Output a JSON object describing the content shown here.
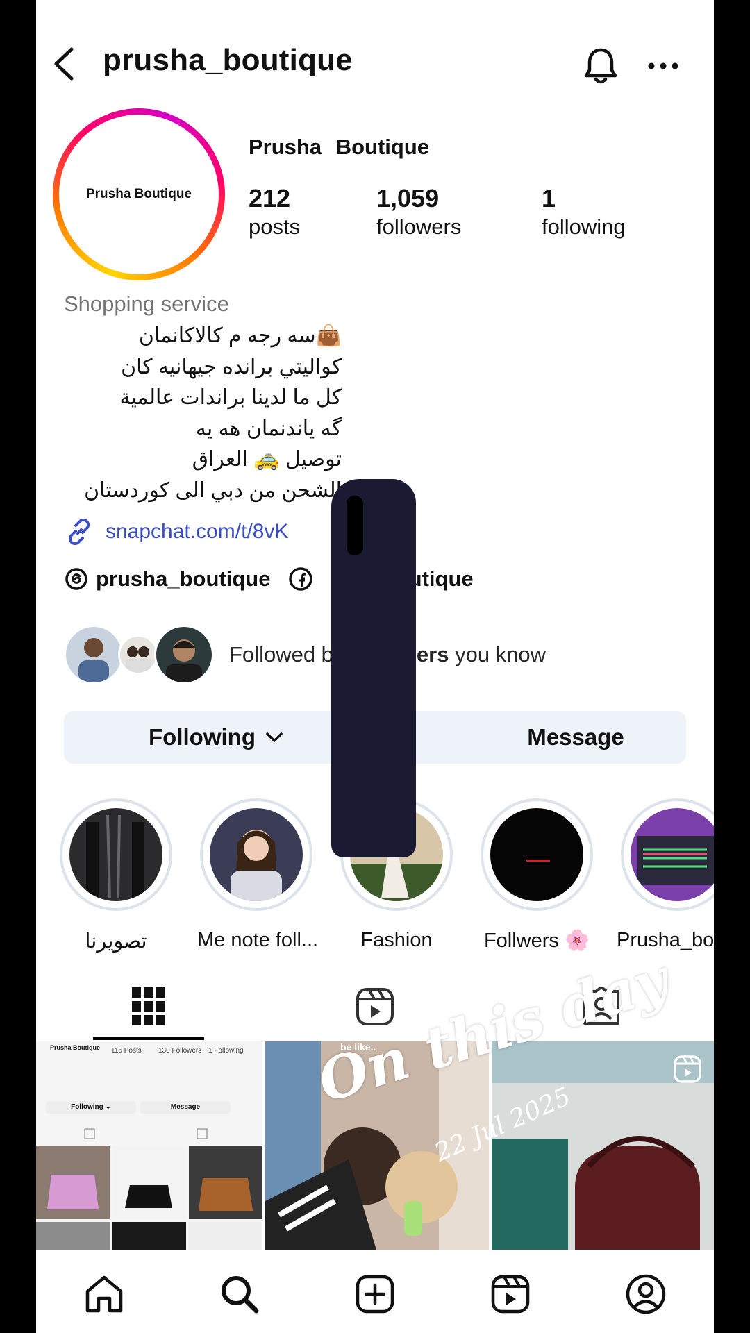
{
  "header": {
    "username": "prusha_boutique"
  },
  "profile": {
    "avatar_text": "Prusha Boutique",
    "display_name": "Prusha Boutique",
    "stats": [
      {
        "value": "212",
        "label": "posts"
      },
      {
        "value": "1,059",
        "label": "followers"
      },
      {
        "value": "1",
        "label": "following"
      }
    ]
  },
  "bio": {
    "category": "Shopping service",
    "lines": [
      "👜سه رجه م كالاكانمان",
      "كواليتي برانده جيهانيه كان",
      "كل ما لدينا براندات عالمية",
      "گه یاندنمان هه یه",
      "توصيل 🚕 العراق",
      "الشحن من دبي الى كوردستان"
    ],
    "link": "snapchat.com/t/8vK"
  },
  "social": {
    "threads": "prusha_boutique",
    "facebook": "a Boutique"
  },
  "followed_by": {
    "text_start": "Followed b",
    "text_bold": "ers",
    "text_end": " you know"
  },
  "actions": {
    "following_label": "Following",
    "message_label": "Message"
  },
  "highlights": [
    {
      "label": "تصويرنا"
    },
    {
      "label": "Me note foll..."
    },
    {
      "label": "Fashion"
    },
    {
      "label": "Follwers 🌸"
    },
    {
      "label": "Prusha_bo"
    }
  ],
  "grid": {
    "post1": {
      "brand": "Prusha Boutique",
      "stats": [
        "115 Posts",
        "130 Followers",
        "1 Following"
      ],
      "following": "Following ⌄",
      "message": "Message"
    },
    "post2": {
      "top_text": "be like..",
      "overlay": "On this day",
      "date": "22 Jul 2025"
    }
  },
  "colors": {
    "link": "#3b4fc4",
    "button_bg": "#eef3f9",
    "secondary_text": "#737373",
    "redaction": "#1a1b33"
  }
}
